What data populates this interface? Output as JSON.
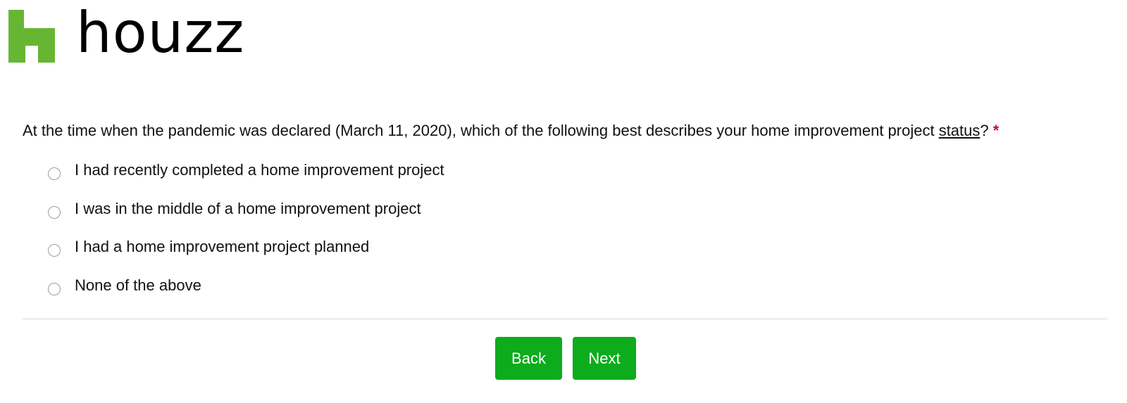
{
  "brand": {
    "name": "houzz",
    "logo_icon": "houzz-h-icon",
    "logo_color": "#66b633"
  },
  "survey": {
    "question": {
      "text_before": "At the time when the pandemic was declared (March 11, 2020), which of the following best describes your home improvement project ",
      "keyword": "status",
      "text_after": "?",
      "required_marker": "*"
    },
    "options": [
      {
        "label": "I had recently completed a home improvement project",
        "selected": false
      },
      {
        "label": "I was in the middle of a home improvement project",
        "selected": false
      },
      {
        "label": "I had a home improvement project planned",
        "selected": false
      },
      {
        "label": "None of the above",
        "selected": false
      }
    ]
  },
  "navigation": {
    "back_label": "Back",
    "next_label": "Next",
    "button_color": "#0cac1c"
  },
  "colors": {
    "required": "#c8102e",
    "text": "#111111"
  }
}
